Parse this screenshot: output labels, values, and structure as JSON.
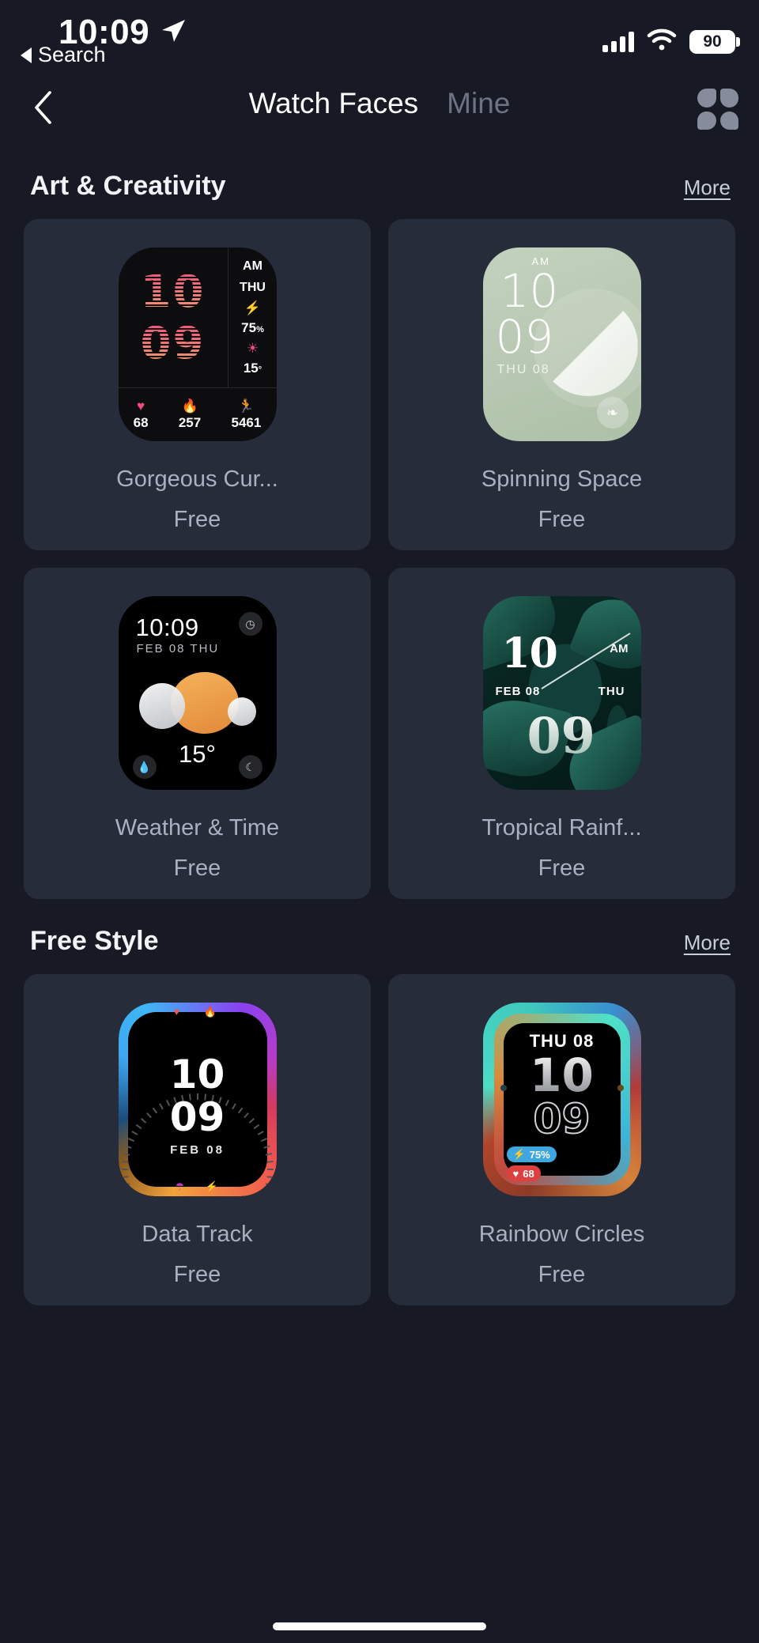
{
  "status_bar": {
    "time": "10:09",
    "location_icon": "location-arrow-icon",
    "signal_icon": "cellular-signal-icon",
    "wifi_icon": "wifi-icon",
    "battery_level": "90",
    "back_to_app_label": "Search",
    "back_triangle_icon": "triangle-left-icon"
  },
  "nav": {
    "back_icon": "chevron-left-icon",
    "tab_active": "Watch Faces",
    "tab_inactive": "Mine",
    "grid_icon": "grid-four-squares-icon"
  },
  "sections": [
    {
      "title": "Art & Creativity",
      "more_label": "More",
      "items": [
        {
          "name": "Gorgeous Cur...",
          "price": "Free",
          "preview": {
            "style": "retro-striped-digits",
            "hour": "10",
            "minute": "09",
            "ampm": "AM",
            "weekday": "THU",
            "battery": "75",
            "battery_unit": "%",
            "temperature": "15",
            "temperature_unit": "°",
            "bolt_icon": "bolt-icon",
            "sun_icon": "sun-icon",
            "stats": [
              {
                "icon": "heart-icon",
                "value": "68"
              },
              {
                "icon": "flame-icon",
                "value": "257"
              },
              {
                "icon": "runner-icon",
                "value": "5461"
              }
            ]
          }
        },
        {
          "name": "Spinning Space",
          "price": "Free",
          "preview": {
            "style": "sage-spinner",
            "ampm": "AM",
            "hour": "10",
            "minute": "09",
            "date": "THU 08",
            "badge_icon": "leaf-icon"
          }
        },
        {
          "name": "Weather & Time",
          "price": "Free",
          "preview": {
            "style": "weather-sun-clouds",
            "time": "10:09",
            "date": "FEB 08 THU",
            "temperature": "15°",
            "top_right_icon": "stopwatch-icon",
            "bottom_left_icon": "humidity-drop-icon",
            "bottom_right_icon": "moon-icon"
          }
        },
        {
          "name": "Tropical Rainf...",
          "price": "Free",
          "preview": {
            "style": "tropical-leaves",
            "hour": "10",
            "ampm": "AM",
            "month_day": "FEB 08",
            "weekday": "THU",
            "minute": "09"
          }
        }
      ]
    },
    {
      "title": "Free Style",
      "more_label": "More",
      "items": [
        {
          "name": "Data Track",
          "price": "Free",
          "preview": {
            "style": "rainbow-ring-ticks",
            "hour": "10",
            "minute": "09",
            "date": "FEB  08",
            "glyphs": [
              "heart-icon",
              "flame-icon",
              "umbrella-icon",
              "bolt-icon"
            ]
          }
        },
        {
          "name": "Rainbow Circles",
          "price": "Free",
          "preview": {
            "style": "rainbow-concentric",
            "weekday": "THU 08",
            "hour": "10",
            "minute": "09",
            "battery_pill": {
              "icon": "bolt-icon",
              "value": "75%"
            },
            "heart_pill": {
              "icon": "heart-icon",
              "value": "68"
            }
          }
        }
      ]
    }
  ],
  "home_indicator": "home-indicator"
}
